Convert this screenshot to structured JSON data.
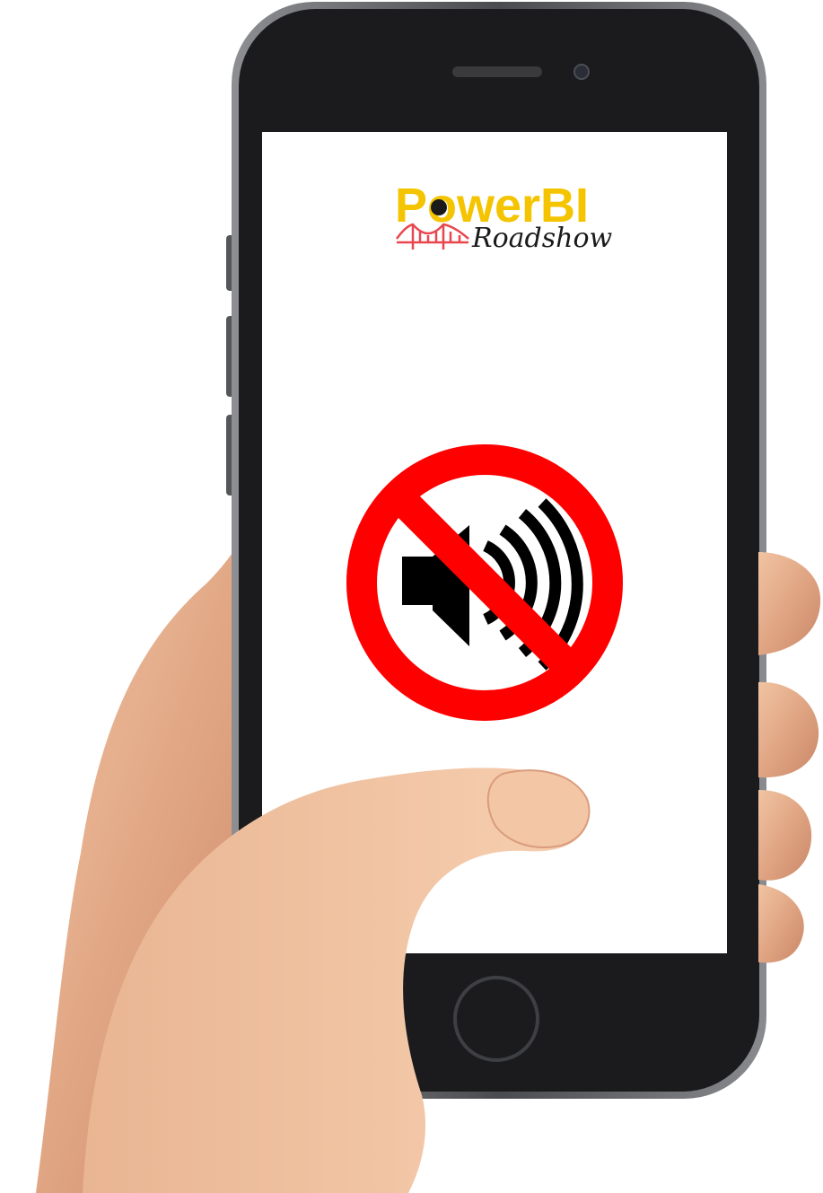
{
  "logo": {
    "wordmark": "PowerBI",
    "subtitle": "Roadshow",
    "brand_color": "#f5c400",
    "bridge_color": "#e8474f",
    "text_color": "#1a1a1a"
  },
  "screen": {
    "background": "#ffffff",
    "icon": "muted-speaker-icon",
    "prohibition_color": "#ff0000",
    "speaker_color": "#000000"
  },
  "device": {
    "body_color": "#1b1b1d",
    "frame_color": "#6a6b6f"
  }
}
